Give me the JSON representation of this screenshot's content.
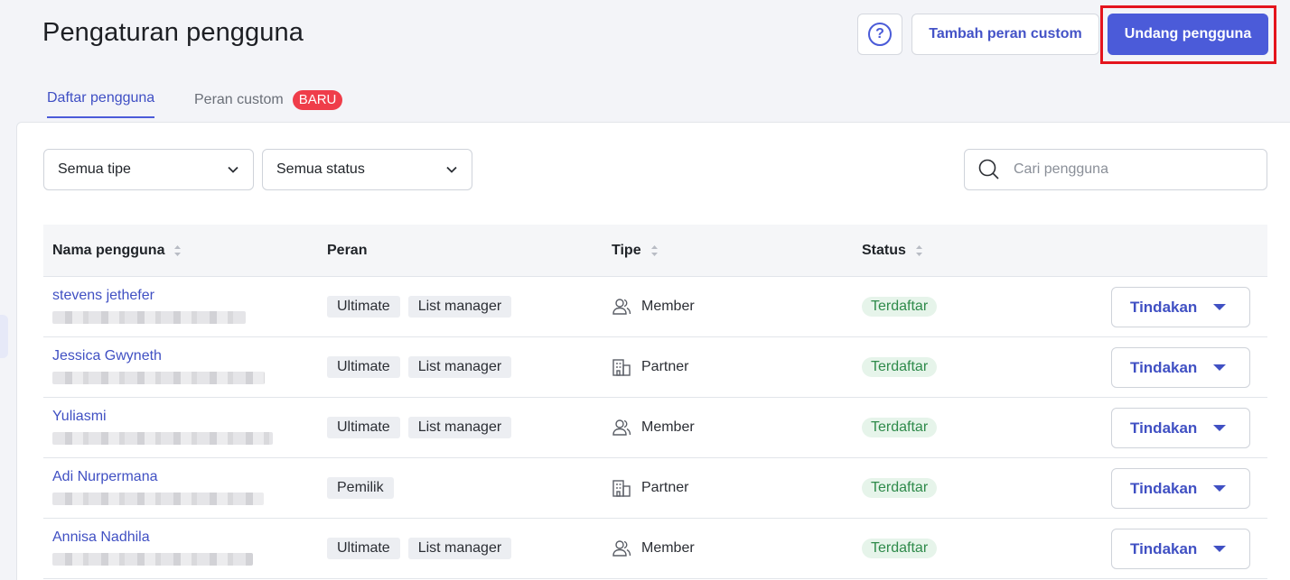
{
  "header": {
    "title": "Pengaturan pengguna",
    "help_label": "?",
    "custom_role_button": "Tambah peran custom",
    "invite_button": "Undang pengguna"
  },
  "tabs": [
    {
      "label": "Daftar pengguna",
      "active": true
    },
    {
      "label": "Peran custom",
      "badge": "BARU",
      "active": false
    }
  ],
  "filters": {
    "type": "Semua tipe",
    "status": "Semua status",
    "search_placeholder": "Cari pengguna"
  },
  "columns": [
    "Nama pengguna",
    "Peran",
    "Tipe",
    "Status"
  ],
  "rows": [
    {
      "name": "stevens jethefer",
      "roles": [
        "Ultimate",
        "List manager"
      ],
      "type": "Member",
      "type_icon": "users-icon",
      "status": "Terdaftar",
      "action": "Tindakan"
    },
    {
      "name": "Jessica Gwyneth",
      "roles": [
        "Ultimate",
        "List manager"
      ],
      "type": "Partner",
      "type_icon": "building-icon",
      "status": "Terdaftar",
      "action": "Tindakan"
    },
    {
      "name": "Yuliasmi",
      "roles": [
        "Ultimate",
        "List manager"
      ],
      "type": "Member",
      "type_icon": "users-icon",
      "status": "Terdaftar",
      "action": "Tindakan"
    },
    {
      "name": "Adi Nurpermana",
      "roles": [
        "Pemilik"
      ],
      "type": "Partner",
      "type_icon": "building-icon",
      "status": "Terdaftar",
      "action": "Tindakan"
    },
    {
      "name": "Annisa Nadhila",
      "roles": [
        "Ultimate",
        "List manager"
      ],
      "type": "Member",
      "type_icon": "users-icon",
      "status": "Terdaftar",
      "action": "Tindakan"
    }
  ],
  "colors": {
    "accent": "#4b5bd9",
    "link": "#4050c3",
    "badge_new": "#ef3d4a",
    "status_bg": "#e6f4ea",
    "status_text": "#2e8a4a",
    "highlight": "#e4141d"
  }
}
